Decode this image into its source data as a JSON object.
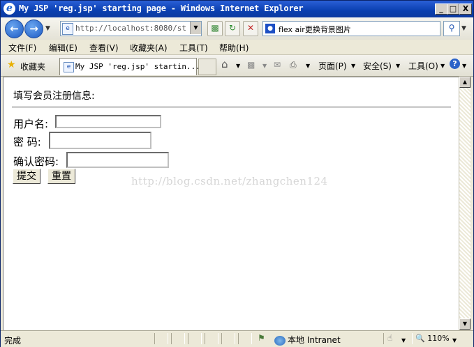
{
  "window": {
    "title": "My JSP 'reg.jsp' starting page - Windows Internet Explorer",
    "min": "_",
    "max": "□",
    "close": "X"
  },
  "address": {
    "url": "http://localhost:8080/strut",
    "search_query": "flex air更换背景图片"
  },
  "menu": [
    "文件(F)",
    "编辑(E)",
    "查看(V)",
    "收藏夹(A)",
    "工具(T)",
    "帮助(H)"
  ],
  "favbar": {
    "favorites": "收藏夹",
    "tab_title": "My JSP 'reg.jsp' startin...",
    "page": "页面(P)",
    "safety": "安全(S)",
    "tools": "工具(O)"
  },
  "page": {
    "heading": "填写会员注册信息:",
    "username_label": "用户名:",
    "password_label": "密  码:",
    "confirm_label": "确认密码:",
    "submit": "提交",
    "reset": "重置",
    "watermark": "http://blog.csdn.net/zhangchen124"
  },
  "status": {
    "text": "完成",
    "zone": "本地 Intranet",
    "zoom": "110%"
  }
}
